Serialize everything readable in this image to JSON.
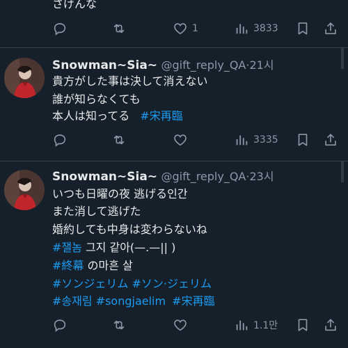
{
  "top_tweet": {
    "tail_text": "さげんな",
    "likes": "1",
    "views": "3833"
  },
  "tweets": [
    {
      "name": "Snowman~Sia~",
      "handle": "@gift_reply_QA",
      "sep": "·",
      "time": "21시",
      "lines": {
        "l1": "貴方がした事は決して消えない",
        "l2": "誰が知らなくても",
        "l3_text": "本人は知ってる",
        "l3_tag": "#宋再臨"
      },
      "views": "3335"
    },
    {
      "name": "Snowman~Sia~",
      "handle": "@gift_reply_QA",
      "sep": "·",
      "time": "23시",
      "lines": {
        "l1": "いつも日曜の夜 逃げる인간",
        "l2": "また消して逃げた",
        "l3": "婚約しても中身は変わらないね",
        "l4_tag": "#잴놈",
        "l4_text": " 그지 같아(—.—|| )",
        "l5_tag": "#終幕",
        "l5_text": " の마흔 살",
        "l6_tag1": "#ソンジェリム",
        "l6_tag2": "#ソン·ジェリム",
        "l7_tag1": "#송재림",
        "l7_tag2": "#songjaelim",
        "l7_tag3": "#宋再臨"
      },
      "views": "1.1만"
    }
  ],
  "icons": [
    "reply-icon",
    "retweet-icon",
    "like-icon",
    "views-icon",
    "bookmark-icon",
    "share-icon"
  ],
  "colors": {
    "background": "#15202b",
    "text": "#e7e9ea",
    "secondary": "#8b98a5",
    "hashtag": "#1d9bf0",
    "divider": "#38444d"
  }
}
